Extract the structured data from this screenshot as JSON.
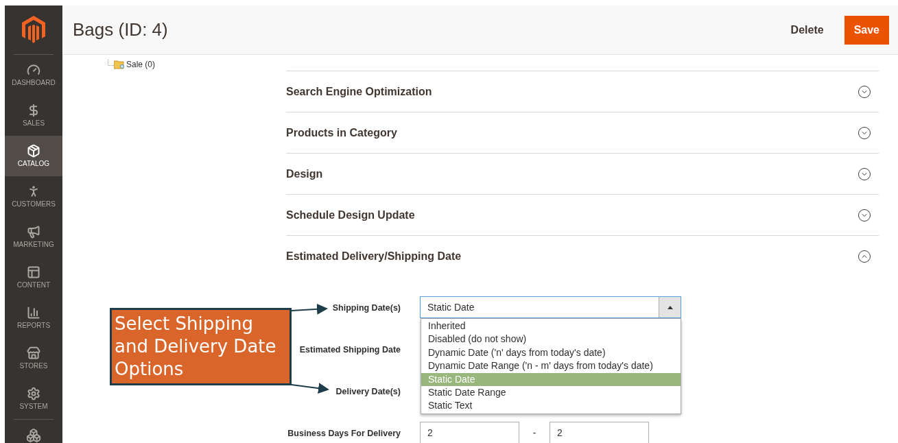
{
  "header": {
    "title": "Bags (ID: 4)",
    "actions": [
      {
        "label": "Delete",
        "kind": "link"
      },
      {
        "label": "Save",
        "kind": "primary"
      }
    ]
  },
  "sidebar": {
    "items": [
      {
        "label": "DASHBOARD",
        "selected": false
      },
      {
        "label": "SALES",
        "selected": false
      },
      {
        "label": "CATALOG",
        "selected": true
      },
      {
        "label": "CUSTOMERS",
        "selected": false
      },
      {
        "label": "MARKETING",
        "selected": false
      },
      {
        "label": "CONTENT",
        "selected": false
      },
      {
        "label": "REPORTS",
        "selected": false
      },
      {
        "label": "STORES",
        "selected": false
      },
      {
        "label": "SYSTEM",
        "selected": false
      }
    ]
  },
  "tree": {
    "items": [
      {
        "label": "Sale (0)"
      }
    ]
  },
  "sections": [
    {
      "title": "Search Engine Optimization",
      "expanded": false
    },
    {
      "title": "Products in Category",
      "expanded": false
    },
    {
      "title": "Design",
      "expanded": false
    },
    {
      "title": "Schedule Design Update",
      "expanded": false
    },
    {
      "title": "Estimated Delivery/Shipping Date",
      "expanded": true
    }
  ],
  "form": {
    "fields": [
      {
        "label": "Shipping Date(s)",
        "kind": "select",
        "value": "Static Date",
        "open": true,
        "options": [
          {
            "label": "Inherited",
            "selected": false
          },
          {
            "label": "Disabled (do not show)",
            "selected": false
          },
          {
            "label": "Dynamic Date ('n' days from today's date)",
            "selected": false
          },
          {
            "label": "Dynamic Date Range ('n - m' days from today's date)",
            "selected": false
          },
          {
            "label": "Static Date",
            "selected": true
          },
          {
            "label": "Static Date Range",
            "selected": false
          },
          {
            "label": "Static Text",
            "selected": false
          }
        ]
      },
      {
        "label": "Estimated Shipping Date",
        "kind": "covered"
      },
      {
        "label": "Delivery Date(s)",
        "kind": "covered"
      },
      {
        "label": "Business Days For Delivery",
        "kind": "range",
        "from": "2",
        "separator": "-",
        "to": "2"
      }
    ]
  },
  "callout": {
    "text": "Select Shipping and Delivery Date Options"
  }
}
